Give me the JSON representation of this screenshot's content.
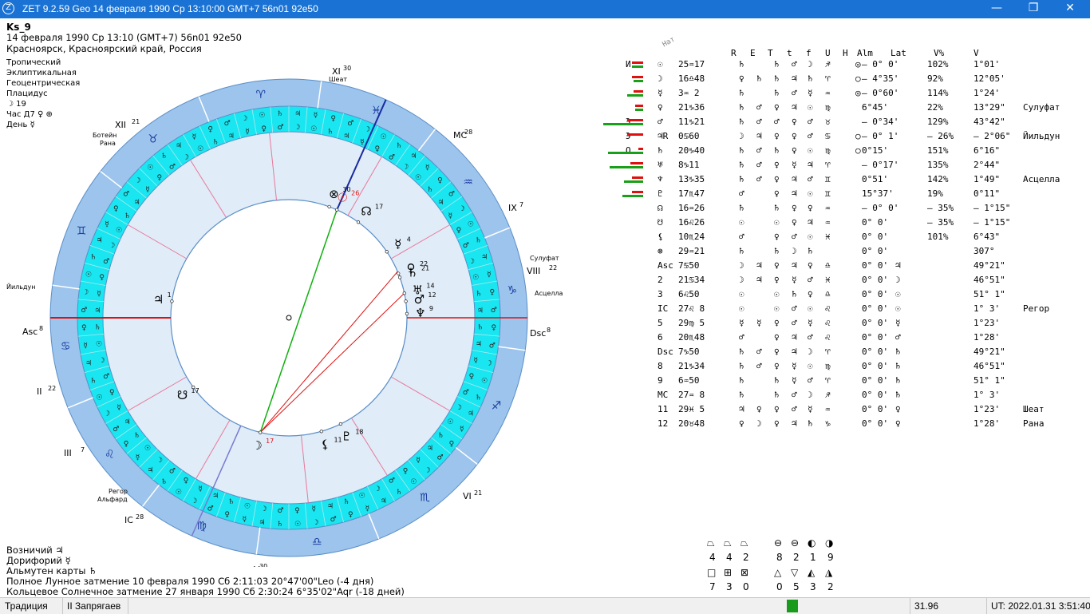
{
  "window": {
    "title": "ZET 9.2.59 Geo   14 февраля 1990  Ср  13:10:00 GMT+7 56n01  92e50",
    "minimize": "—",
    "maximize": "❐",
    "close": "✕"
  },
  "header": {
    "name": "Ks_9",
    "datetime": "14 февраля 1990  Ср  13:10 (GMT+7) 56n01  92e50",
    "place": "Красноярск, Красноярский край, Россия",
    "zodiac": "Тропический",
    "coords": "Эклиптикальная",
    "centric": "Геоцентрическая",
    "houses": "Плацидус",
    "moon_day": "☽  19",
    "hour": "Час Д7  ♀  ⊕",
    "day": "День  ☿"
  },
  "bottom": {
    "charioteer": "Возничий   ♃",
    "doryphory": "Дорифорий   ☿",
    "almuten": "Альмутен карты   ♄",
    "eclipse1": "Полное Лунное затмение 10 февраля 1990 Сб  2:11:03 20°47'00\"Leo (-4 дня)",
    "eclipse2": "Кольцевое Солнечное затмение 27 января 1990 Сб  2:30:24  6°35'02\"Aqr (-18 дней)"
  },
  "status": {
    "tradition": "Традиция",
    "mode": "II Запрягаев",
    "value": "31.96",
    "ut": "UT: 2022.01.31  3:51:40"
  },
  "table": {
    "nat_label": "Нат",
    "headers": [
      "R",
      "E",
      "T",
      "t",
      "f",
      "U",
      "H",
      "Alm",
      "Lat",
      "V%",
      "V"
    ],
    "rows": [
      [
        "И",
        "☉",
        "25♒17",
        "♄",
        "",
        "♄",
        "♂",
        "☽",
        "♐",
        "◎",
        "",
        "– 0° 0'",
        "102%",
        "1°01'",
        ""
      ],
      [
        "",
        "☽",
        "16♎48",
        "♀",
        "♄",
        "♄",
        "♃",
        "♄",
        "♈",
        "○",
        "",
        "– 4°35'",
        "92%",
        "12°05'",
        ""
      ],
      [
        "",
        "☿",
        "3♒ 2",
        "♄",
        "",
        "♄",
        "♂",
        "☿",
        "♒",
        "◎",
        "",
        "– 0°60'",
        "114%",
        "1°24'",
        ""
      ],
      [
        "",
        "♀",
        "21♑36",
        "♄",
        "♂",
        "♀",
        "♃",
        "☉",
        "♍",
        "",
        "",
        "6°45'",
        "22%",
        "13°29\"",
        "Сулуфат"
      ],
      [
        "Э",
        "♂",
        "11♑21",
        "♄",
        "♂",
        "♂",
        "♀",
        "♂",
        "♉",
        "",
        "",
        "– 0°34'",
        "129%",
        "43°42\"",
        ""
      ],
      [
        "Э",
        "♃R",
        "0♋60",
        "☽",
        "♃",
        "♀",
        "♀",
        "♂",
        "♋",
        "○",
        "",
        "– 0° 1'",
        "– 26%",
        "– 2°06\"",
        "Йильдун"
      ],
      [
        "О",
        "♄",
        "20♑40",
        "♄",
        "♂",
        "♄",
        "♀",
        "☉",
        "♍",
        "○",
        "",
        "0°15'",
        "151%",
        "6°16\"",
        ""
      ],
      [
        "",
        "♅",
        "8♑11",
        "♄",
        "♂",
        "♀",
        "☿",
        "♃",
        "♈",
        "",
        "",
        "– 0°17'",
        "135%",
        "2°44\"",
        ""
      ],
      [
        "",
        "♆",
        "13♑35",
        "♄",
        "♂",
        "♀",
        "♃",
        "♂",
        "♊",
        "",
        "",
        "0°51'",
        "142%",
        "1°49\"",
        "Асцелла"
      ],
      [
        "",
        "♇",
        "17♏47",
        "♂",
        "",
        "♀",
        "♃",
        "☉",
        "♊",
        "",
        "",
        "15°37'",
        "19%",
        "0°11\"",
        ""
      ],
      [
        "",
        "☊",
        "16♒26",
        "♄",
        "",
        "♄",
        "♀",
        "♀",
        "♒",
        "",
        "",
        "– 0° 0'",
        "– 35%",
        "– 1°15\"",
        ""
      ],
      [
        "",
        "☋",
        "16♌26",
        "☉",
        "",
        "☉",
        "♀",
        "♃",
        "♒",
        "",
        "",
        "0° 0'",
        "– 35%",
        "– 1°15\"",
        ""
      ],
      [
        "",
        "⚸",
        "10♏24",
        "♂",
        "",
        "♀",
        "♂",
        "☉",
        "♓",
        "",
        "",
        "0° 0'",
        "101%",
        "6°43\"",
        ""
      ],
      [
        "",
        "⊗",
        "29♒21",
        "♄",
        "",
        "♄",
        "☽",
        "♄",
        "",
        "",
        "",
        "0° 0'",
        "",
        "307°",
        ""
      ],
      [
        "",
        "Asc",
        "7♋50",
        "☽",
        "♃",
        "♀",
        "♃",
        "♀",
        "♎",
        "",
        "♃",
        "0° 0'",
        "",
        "49°21\"",
        ""
      ],
      [
        "",
        "2",
        "21♋34",
        "☽",
        "♃",
        "♀",
        "☿",
        "♂",
        "♓",
        "",
        "☽",
        "0° 0'",
        "",
        "46°51\"",
        ""
      ],
      [
        "",
        "3",
        "6♌50",
        "☉",
        "",
        "☉",
        "♄",
        "♀",
        "♎",
        "",
        "☉",
        "0° 0'",
        "",
        "51° 1\"",
        ""
      ],
      [
        "",
        "IC",
        "27♌ 8",
        "☉",
        "",
        "☉",
        "♂",
        "☉",
        "♌",
        "",
        "☉",
        "0° 0'",
        "",
        "1° 3'",
        "Регор"
      ],
      [
        "",
        "5",
        "29♍ 5",
        "☿",
        "☿",
        "♀",
        "♂",
        "☿",
        "♌",
        "",
        "☿",
        "0° 0'",
        "",
        "1°23'",
        ""
      ],
      [
        "",
        "6",
        "20♏48",
        "♂",
        "",
        "♀",
        "♃",
        "♂",
        "♌",
        "",
        "♂",
        "0° 0'",
        "",
        "1°28'",
        ""
      ],
      [
        "",
        "Dsc",
        "7♑50",
        "♄",
        "♂",
        "♀",
        "♃",
        "☽",
        "♈",
        "",
        "♄",
        "0° 0'",
        "",
        "49°21\"",
        ""
      ],
      [
        "",
        "8",
        "21♑34",
        "♄",
        "♂",
        "♀",
        "☿",
        "☉",
        "♍",
        "",
        "♄",
        "0° 0'",
        "",
        "46°51\"",
        ""
      ],
      [
        "",
        "9",
        "6♒50",
        "♄",
        "",
        "♄",
        "☿",
        "♂",
        "♈",
        "",
        "♄",
        "0° 0'",
        "",
        "51° 1\"",
        ""
      ],
      [
        "",
        "MC",
        "27♒ 8",
        "♄",
        "",
        "♄",
        "♂",
        "☽",
        "♐",
        "",
        "♄",
        "0° 0'",
        "",
        "1° 3'",
        ""
      ],
      [
        "",
        "11",
        "29♓ 5",
        "♃",
        "♀",
        "♀",
        "♂",
        "☿",
        "♒",
        "",
        "♀",
        "0° 0'",
        "",
        "1°23'",
        "Шеат"
      ],
      [
        "",
        "12",
        "20♉48",
        "♀",
        "☽",
        "♀",
        "♃",
        "♄",
        "♑",
        "",
        "♀",
        "0° 0'",
        "",
        "1°28'",
        "Рана"
      ]
    ]
  },
  "patterns": {
    "row1": {
      "symbols": [
        "⏢",
        "⏢",
        "⏢",
        "⊖",
        "⊖",
        "◐",
        "◑"
      ],
      "counts": [
        "4",
        "4",
        "2",
        "8",
        "2",
        "1",
        "9"
      ]
    },
    "row2": {
      "symbols": [
        "□",
        "⊞",
        "⊠",
        "△",
        "▽",
        "◭",
        "◮"
      ],
      "counts": [
        "7",
        "3",
        "0",
        "0",
        "5",
        "3",
        "2"
      ]
    }
  },
  "chart": {
    "asc_label": "Asc",
    "asc_sup": "8",
    "dsc_label": "Dsc",
    "dsc_sup": "8",
    "ic_label": "IC",
    "ic_sup": "28",
    "mc_label": "MC",
    "mc_sup": "28",
    "house_labels": [
      {
        "label": "XI",
        "sup": "30"
      },
      {
        "label": "XII",
        "sup": "21"
      },
      {
        "label": "II",
        "sup": "22"
      },
      {
        "label": "III",
        "sup": "7"
      },
      {
        "label": "V",
        "sup": "30"
      },
      {
        "label": "VI",
        "sup": "21"
      },
      {
        "label": "VIII",
        "sup": "22"
      },
      {
        "label": "IX",
        "sup": "7"
      }
    ],
    "stars": [
      "Шеат",
      "Ботейн",
      "Рана",
      "Йильдун",
      "Сулуфат",
      "Асцелла",
      "Регор",
      "Альфард"
    ],
    "signs": [
      "♈",
      "♉",
      "♊",
      "♋",
      "♌",
      "♍",
      "♎",
      "♏",
      "♐",
      "♑",
      "♒",
      "♓"
    ],
    "planet_labels": [
      {
        "sym": "⊗",
        "deg": "30"
      },
      {
        "sym": "☉",
        "deg": "26"
      },
      {
        "sym": "☊",
        "deg": "17"
      },
      {
        "sym": "☿",
        "deg": "4"
      },
      {
        "sym": "♀",
        "deg": "22"
      },
      {
        "sym": "♄",
        "deg": "21"
      },
      {
        "sym": "♅",
        "deg": "14"
      },
      {
        "sym": "♂",
        "deg": "12"
      },
      {
        "sym": "♆",
        "deg": "9"
      },
      {
        "sym": "♇",
        "deg": "18"
      },
      {
        "sym": "⚸",
        "deg": "11"
      },
      {
        "sym": "☽",
        "deg": "17"
      },
      {
        "sym": "☋",
        "deg": "17"
      },
      {
        "sym": "♃",
        "deg": "1"
      }
    ]
  }
}
